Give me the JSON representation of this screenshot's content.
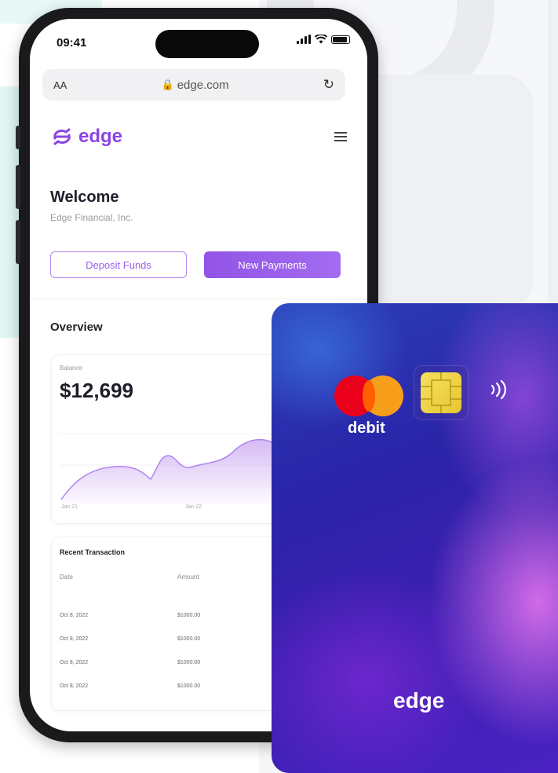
{
  "status_bar": {
    "time": "09:41"
  },
  "browser": {
    "aa": "AA",
    "url": "edge.com"
  },
  "header": {
    "logo_text": "edge"
  },
  "welcome": {
    "title": "Welcome",
    "company": "Edge Financial, Inc."
  },
  "actions": {
    "deposit_label": "Deposit Funds",
    "new_payments_label": "New Payments"
  },
  "overview": {
    "title": "Overview",
    "balance_label": "Balance",
    "balance_value": "$12,699",
    "ticks": [
      "Jan 21",
      "Jan 22"
    ]
  },
  "transactions": {
    "title": "Recent Transaction",
    "columns": [
      "Date",
      "Amount"
    ],
    "rows": [
      {
        "date": "Oct 8, 2022",
        "amount": "$1000.00"
      },
      {
        "date": "Oct 8, 2022",
        "amount": "$1000.00"
      },
      {
        "date": "Oct 8, 2022",
        "amount": "$1000.00"
      },
      {
        "date": "Oct 8, 2022",
        "amount": "$1000.00"
      }
    ]
  },
  "debit_card": {
    "type_label": "debit",
    "brand": "edge"
  },
  "colors": {
    "accent": "#8b45e6",
    "card_primary": "#2a24a8",
    "card_highlight": "#eb78f0"
  },
  "icons": [
    "signal-icon",
    "wifi-icon",
    "battery-icon",
    "lock-icon",
    "reload-icon",
    "edge-logo-icon",
    "menu-icon",
    "mastercard-icon",
    "chip-icon",
    "contactless-icon"
  ]
}
